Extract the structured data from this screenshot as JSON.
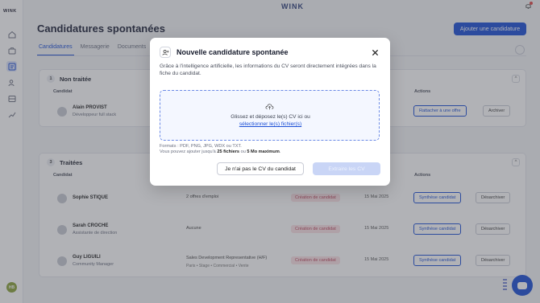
{
  "app": {
    "brand": "WINK",
    "sidebar_logo": "WINK",
    "user_initials": "HB"
  },
  "sidebar": {
    "items": [
      {
        "icon": "home-icon"
      },
      {
        "icon": "briefcase-icon"
      },
      {
        "icon": "candidates-board-icon",
        "active": true
      },
      {
        "icon": "users-icon"
      },
      {
        "icon": "inbox-icon"
      },
      {
        "icon": "stats-icon"
      }
    ]
  },
  "header": {
    "title": "Candidatures spontanées",
    "add_button": "Ajouter une candidature"
  },
  "tabs": [
    "Candidatures",
    "Messagerie",
    "Documents"
  ],
  "sections": {
    "untreated": {
      "count": "1",
      "title": "Non traitée",
      "col_candidate": "Candidat",
      "col_actions": "Actions",
      "rows": [
        {
          "name": "Alain PROVIST",
          "role": "Développeur full stack",
          "action1": "Rattacher à une offre",
          "action2": "Archiver"
        }
      ]
    },
    "treated": {
      "count": "3",
      "title": "Traitées",
      "col_candidate": "Candidat",
      "col_actions": "Actions",
      "rows": [
        {
          "name": "Sophie STIQUE",
          "role": "",
          "offers": "2 offres d'emploi",
          "tags": "",
          "status": "Création de candidat",
          "date": "15 Mai 2025",
          "action1": "Synthèse candidat",
          "action2": "Désarchiver"
        },
        {
          "name": "Sarah CROCHE",
          "role": "Assistante de direction",
          "offers": "Aucune",
          "tags": "",
          "status": "Création de candidat",
          "date": "15 Mai 2025",
          "action1": "Synthèse candidat",
          "action2": "Désarchiver"
        },
        {
          "name": "Guy LIGUILI",
          "role": "Community Manager",
          "offers": "Sales Development Representative (H/F)",
          "tags": "Paris • Stage • Commercial • Vente",
          "status": "Création de candidat",
          "date": "15 Mai 2025",
          "action1": "Synthèse candidat",
          "action2": "Désarchiver"
        }
      ]
    }
  },
  "modal": {
    "title": "Nouvelle candidature spontanée",
    "description": "Grâce à l'intelligence artificielle, les informations du CV seront directement intégrées dans la fiche du candidat.",
    "dropzone_text": "Glissez et déposez le(s) CV ici ou",
    "dropzone_link": "sélectionner le(s) fichier(s)",
    "formats": "Formats : PDF, PNG, JPG, WDX ou TXT.",
    "limits_prefix": "Vous pouvez ajouter jusqu'à ",
    "limits_files": "25 fichiers",
    "limits_mid": " ou ",
    "limits_size": "5 Mo maximum",
    "limits_suffix": ".",
    "no_cv_button": "Je n'ai pas le CV du candidat",
    "submit_button": "Extraire les CV",
    "accent": "#1b4fd6"
  }
}
